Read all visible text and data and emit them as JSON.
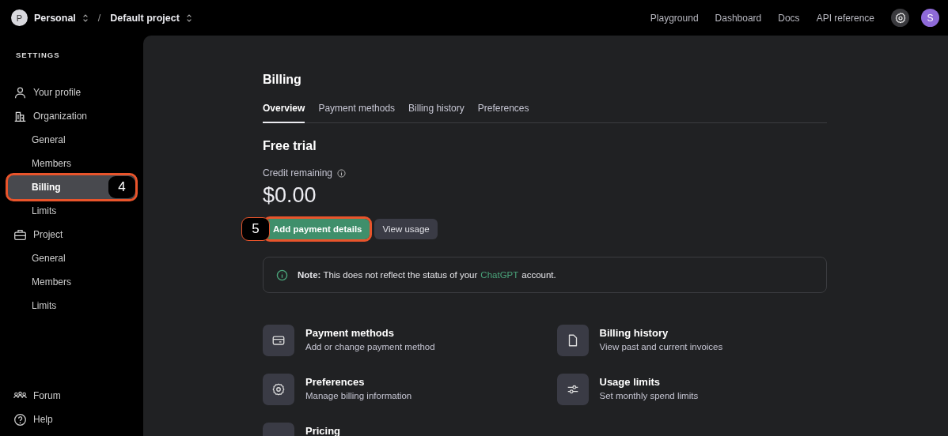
{
  "topbar": {
    "org": {
      "initial": "P",
      "name": "Personal"
    },
    "separator": "/",
    "project": "Default project",
    "links": [
      "Playground",
      "Dashboard",
      "Docs",
      "API reference"
    ],
    "avatar": "S"
  },
  "sidebar": {
    "heading": "SETTINGS",
    "items": [
      {
        "label": "Your profile",
        "kind": "section",
        "selected": false
      },
      {
        "label": "Organization",
        "kind": "section",
        "selected": false
      },
      {
        "label": "General",
        "kind": "sub",
        "selected": false
      },
      {
        "label": "Members",
        "kind": "sub",
        "selected": false
      },
      {
        "label": "Billing",
        "kind": "sub",
        "selected": true,
        "callout": "4"
      },
      {
        "label": "Limits",
        "kind": "sub",
        "selected": false
      },
      {
        "label": "Project",
        "kind": "section",
        "selected": false
      },
      {
        "label": "General",
        "kind": "sub",
        "selected": false
      },
      {
        "label": "Members",
        "kind": "sub",
        "selected": false
      },
      {
        "label": "Limits",
        "kind": "sub",
        "selected": false
      }
    ],
    "footer": [
      {
        "label": "Forum"
      },
      {
        "label": "Help"
      }
    ]
  },
  "page": {
    "title": "Billing",
    "tabs": [
      {
        "label": "Overview",
        "selected": true
      },
      {
        "label": "Payment methods",
        "selected": false
      },
      {
        "label": "Billing history",
        "selected": false
      },
      {
        "label": "Preferences",
        "selected": false
      }
    ],
    "plan": "Free trial",
    "credit_label": "Credit remaining",
    "credit": "$0.00",
    "buttons": [
      {
        "label": "Add payment details",
        "kind": "primary",
        "callout": "5"
      },
      {
        "label": "View usage",
        "kind": "secondary"
      }
    ],
    "note": "**Note:** This does not reflect the status of your",
    "note_link": "ChatGPT",
    "note_end": "account.",
    "cards": [
      {
        "title": "Payment methods",
        "subtitle": "Add or change payment method"
      },
      {
        "title": "Billing history",
        "subtitle": "View past and current invoices"
      },
      {
        "title": "Preferences",
        "subtitle": "Manage billing information"
      },
      {
        "title": "Usage limits",
        "subtitle": "Set monthly spend limits"
      },
      {
        "title": "Pricing"
      }
    ]
  }
}
